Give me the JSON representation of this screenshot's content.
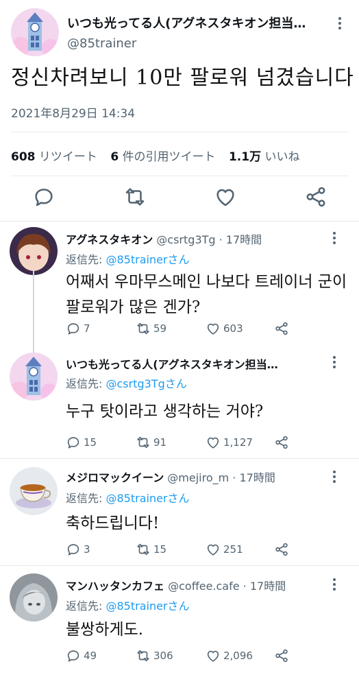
{
  "main": {
    "name": "いつも光ってる人(アグネスタキオン担当…",
    "handle": "@85trainer",
    "text": "정신차려보니 10만 팔로워 넘겼습니다",
    "date": "2021年8月29日 14:34",
    "stats": {
      "retweets_num": "608",
      "retweets_label": "リツイート",
      "quotes_num": "6",
      "quotes_label": "件の引用ツイート",
      "likes_num": "1.1万",
      "likes_label": "いいね"
    },
    "icons": [
      "reply-icon",
      "retweet-icon",
      "like-icon",
      "share-icon"
    ]
  },
  "replies": [
    {
      "name": "アグネスタキオン",
      "handle": "@csrtg3Tg · 17時間",
      "reply_to_prefix": "返信先: ",
      "reply_to_link": "@85trainerさん",
      "text_line1": "어째서 우마무스메인 나보다 트레이너 군이",
      "text_line2": "팔로워가 많은 겐가?",
      "replies": "7",
      "retweets": "59",
      "likes": "603"
    },
    {
      "name": "いつも光ってる人(アグネスタキオン担当…",
      "handle": "",
      "reply_to_prefix": "返信先: ",
      "reply_to_link": "@csrtg3Tgさん",
      "text_line1": "누구 탓이라고 생각하는 거야?",
      "replies": "15",
      "retweets": "91",
      "likes": "1,127"
    },
    {
      "name": "メジロマックイーン",
      "handle": "@mejiro_m · 17時間",
      "reply_to_prefix": "返信先: ",
      "reply_to_link": "@85trainerさん",
      "text_line1": "축하드립니다!",
      "replies": "3",
      "retweets": "15",
      "likes": "251"
    },
    {
      "name": "マンハッタンカフェ",
      "handle": "@coffee.cafe · 17時間",
      "reply_to_prefix": "返信先: ",
      "reply_to_link": "@85trainerさん",
      "text_line1": "불쌍하게도.",
      "replies": "49",
      "retweets": "306",
      "likes": "2,096"
    }
  ],
  "colors": {
    "link": "#1d9bf0",
    "muted": "#536471",
    "text": "#0f1419",
    "divider": "#e6ecf0"
  }
}
